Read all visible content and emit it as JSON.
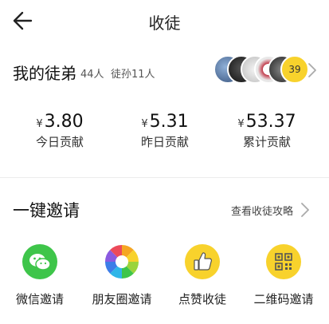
{
  "header": {
    "title": "收徒",
    "back_icon": "back-arrow-icon"
  },
  "disciples": {
    "label": "我的徒弟",
    "disciple_count": "44人",
    "grand_disciple_count": "徒孙11人",
    "more_count": "39",
    "avatar_colors": [
      "#4a6a9a",
      "#2b2b2b",
      "#d8d8d8",
      "#b03040",
      "#3a3a3a"
    ]
  },
  "stats": [
    {
      "currency": "¥",
      "value": "3.80",
      "label": "今日贡献"
    },
    {
      "currency": "¥",
      "value": "5.31",
      "label": "昨日贡献"
    },
    {
      "currency": "¥",
      "value": "53.37",
      "label": "累计贡献"
    }
  ],
  "invite": {
    "title": "一键邀请",
    "guide_link": "查看收徒攻略",
    "actions": [
      {
        "label": "微信邀请",
        "icon": "wechat-icon",
        "color": "#3ec54a"
      },
      {
        "label": "朋友圈邀请",
        "icon": "moments-icon",
        "color": "#ffffff"
      },
      {
        "label": "点赞收徒",
        "icon": "thumbs-up-icon",
        "color": "#f8d22c"
      },
      {
        "label": "二维码邀请",
        "icon": "qr-code-icon",
        "color": "#f8d22c"
      }
    ]
  }
}
